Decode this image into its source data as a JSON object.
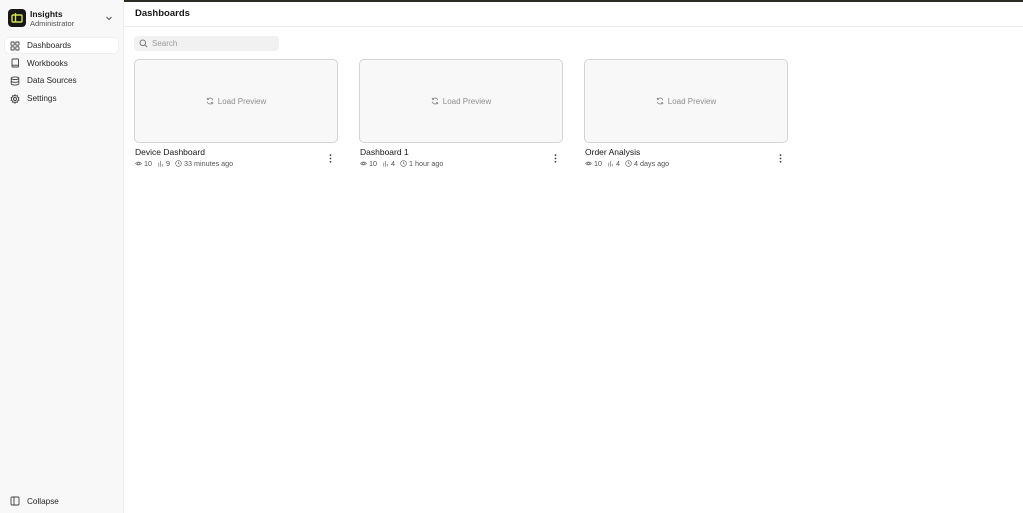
{
  "app": {
    "name": "Insights",
    "role": "Administrator",
    "logo_icon": "insights-logo-icon",
    "accent": "#d4e157"
  },
  "sidebar": {
    "items": [
      {
        "label": "Dashboards",
        "icon": "grid-icon",
        "active": true
      },
      {
        "label": "Workbooks",
        "icon": "book-icon",
        "active": false
      },
      {
        "label": "Data Sources",
        "icon": "database-icon",
        "active": false
      },
      {
        "label": "Settings",
        "icon": "gear-icon",
        "active": false
      }
    ],
    "collapse_label": "Collapse"
  },
  "header": {
    "title": "Dashboards"
  },
  "search": {
    "placeholder": "Search",
    "value": ""
  },
  "cards": [
    {
      "title": "Device Dashboard",
      "preview_label": "Load Preview",
      "views": "10",
      "users": "9",
      "time": "33 minutes ago"
    },
    {
      "title": "Dashboard 1",
      "preview_label": "Load Preview",
      "views": "10",
      "users": "4",
      "time": "1 hour ago"
    },
    {
      "title": "Order Analysis",
      "preview_label": "Load Preview",
      "views": "10",
      "users": "4",
      "time": "4 days ago"
    }
  ]
}
